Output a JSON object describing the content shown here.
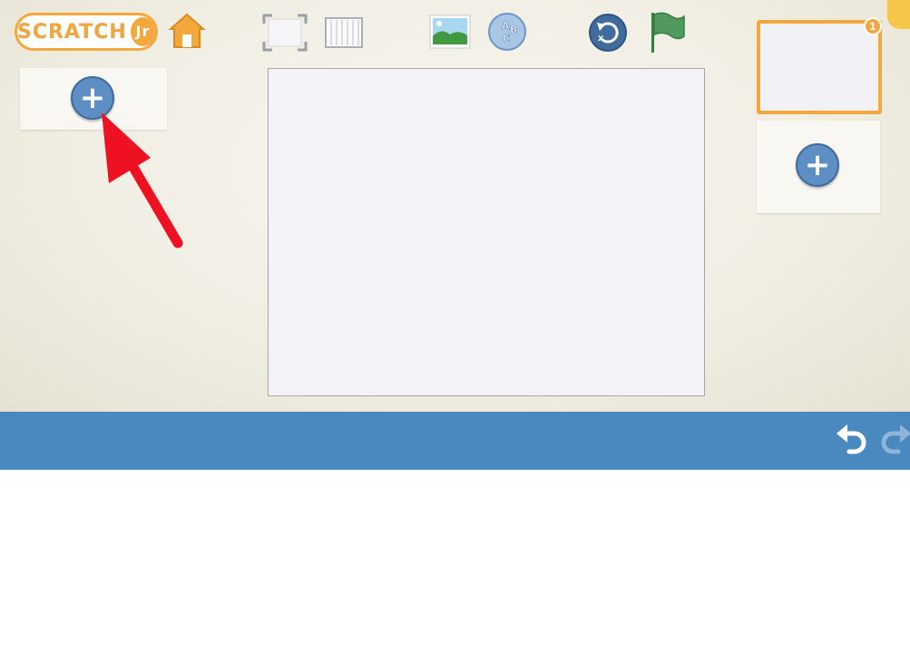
{
  "app": {
    "logo_text": "SCRATCH",
    "logo_suffix": "Jr"
  },
  "toolbar": {
    "icons": [
      "home-icon",
      "fullscreen-icon",
      "grid-icon",
      "background-icon",
      "text-icon",
      "reset-characters-icon",
      "green-flag-icon"
    ]
  },
  "pages": {
    "current_page_number": "1"
  },
  "script_area": {
    "icons": [
      "undo-icon",
      "redo-icon"
    ]
  },
  "colors": {
    "accent_orange": "#f2a83d",
    "script_bar_blue": "#4a88c0",
    "add_button_blue": "#5d8fc4",
    "flag_green": "#4f9a5c",
    "annotation_arrow_red": "#ee1122"
  }
}
